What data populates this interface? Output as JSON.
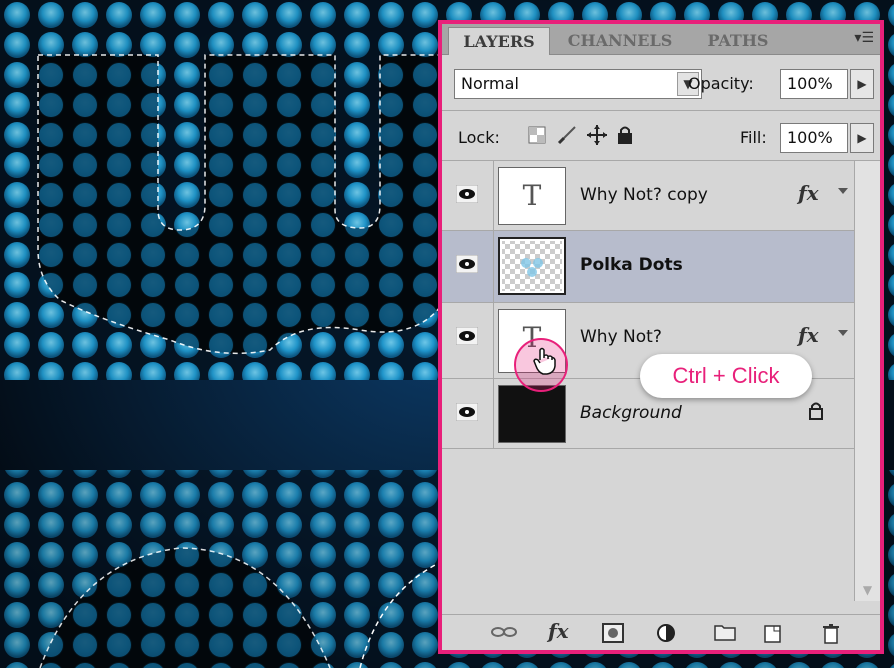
{
  "panel": {
    "tabs": [
      {
        "label": "LAYERS",
        "active": true
      },
      {
        "label": "CHANNELS",
        "active": false
      },
      {
        "label": "PATHS",
        "active": false
      }
    ],
    "menu_icon": "panel-menu-icon",
    "blend_mode": "Normal",
    "opacity_label": "Opacity:",
    "opacity_value": "100%",
    "lock_label": "Lock:",
    "fill_label": "Fill:",
    "fill_value": "100%",
    "layers": [
      {
        "name": "Why Not? copy",
        "thumb": "T",
        "fx": "fx",
        "visible": true,
        "selected": false
      },
      {
        "name": "Polka Dots",
        "thumb": "checker",
        "fx": "",
        "visible": true,
        "selected": true
      },
      {
        "name": "Why Not?",
        "thumb": "T",
        "fx": "fx",
        "visible": true,
        "selected": false
      },
      {
        "name": "Background",
        "thumb": "black",
        "fx": "",
        "visible": true,
        "selected": false,
        "locked": true
      }
    ],
    "bottom_icons": [
      "link-icon",
      "fx-icon",
      "mask-icon",
      "adjustment-icon",
      "group-folder-icon",
      "new-layer-icon",
      "trash-icon"
    ],
    "fx_bottom_label": "fx"
  },
  "annotation": {
    "tooltip": "Ctrl + Click",
    "accent": "#e8207a"
  }
}
